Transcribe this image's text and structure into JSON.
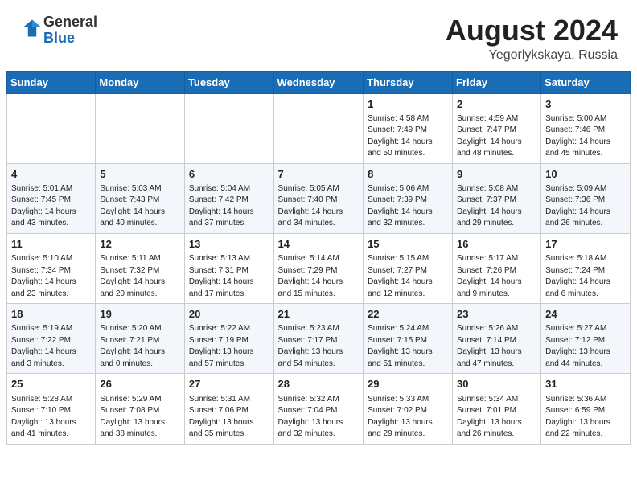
{
  "header": {
    "logo_general": "General",
    "logo_blue": "Blue",
    "month_year": "August 2024",
    "location": "Yegorlykskaya, Russia"
  },
  "days_of_week": [
    "Sunday",
    "Monday",
    "Tuesday",
    "Wednesday",
    "Thursday",
    "Friday",
    "Saturday"
  ],
  "weeks": [
    [
      {
        "day": "",
        "info": ""
      },
      {
        "day": "",
        "info": ""
      },
      {
        "day": "",
        "info": ""
      },
      {
        "day": "",
        "info": ""
      },
      {
        "day": "1",
        "info": "Sunrise: 4:58 AM\nSunset: 7:49 PM\nDaylight: 14 hours\nand 50 minutes."
      },
      {
        "day": "2",
        "info": "Sunrise: 4:59 AM\nSunset: 7:47 PM\nDaylight: 14 hours\nand 48 minutes."
      },
      {
        "day": "3",
        "info": "Sunrise: 5:00 AM\nSunset: 7:46 PM\nDaylight: 14 hours\nand 45 minutes."
      }
    ],
    [
      {
        "day": "4",
        "info": "Sunrise: 5:01 AM\nSunset: 7:45 PM\nDaylight: 14 hours\nand 43 minutes."
      },
      {
        "day": "5",
        "info": "Sunrise: 5:03 AM\nSunset: 7:43 PM\nDaylight: 14 hours\nand 40 minutes."
      },
      {
        "day": "6",
        "info": "Sunrise: 5:04 AM\nSunset: 7:42 PM\nDaylight: 14 hours\nand 37 minutes."
      },
      {
        "day": "7",
        "info": "Sunrise: 5:05 AM\nSunset: 7:40 PM\nDaylight: 14 hours\nand 34 minutes."
      },
      {
        "day": "8",
        "info": "Sunrise: 5:06 AM\nSunset: 7:39 PM\nDaylight: 14 hours\nand 32 minutes."
      },
      {
        "day": "9",
        "info": "Sunrise: 5:08 AM\nSunset: 7:37 PM\nDaylight: 14 hours\nand 29 minutes."
      },
      {
        "day": "10",
        "info": "Sunrise: 5:09 AM\nSunset: 7:36 PM\nDaylight: 14 hours\nand 26 minutes."
      }
    ],
    [
      {
        "day": "11",
        "info": "Sunrise: 5:10 AM\nSunset: 7:34 PM\nDaylight: 14 hours\nand 23 minutes."
      },
      {
        "day": "12",
        "info": "Sunrise: 5:11 AM\nSunset: 7:32 PM\nDaylight: 14 hours\nand 20 minutes."
      },
      {
        "day": "13",
        "info": "Sunrise: 5:13 AM\nSunset: 7:31 PM\nDaylight: 14 hours\nand 17 minutes."
      },
      {
        "day": "14",
        "info": "Sunrise: 5:14 AM\nSunset: 7:29 PM\nDaylight: 14 hours\nand 15 minutes."
      },
      {
        "day": "15",
        "info": "Sunrise: 5:15 AM\nSunset: 7:27 PM\nDaylight: 14 hours\nand 12 minutes."
      },
      {
        "day": "16",
        "info": "Sunrise: 5:17 AM\nSunset: 7:26 PM\nDaylight: 14 hours\nand 9 minutes."
      },
      {
        "day": "17",
        "info": "Sunrise: 5:18 AM\nSunset: 7:24 PM\nDaylight: 14 hours\nand 6 minutes."
      }
    ],
    [
      {
        "day": "18",
        "info": "Sunrise: 5:19 AM\nSunset: 7:22 PM\nDaylight: 14 hours\nand 3 minutes."
      },
      {
        "day": "19",
        "info": "Sunrise: 5:20 AM\nSunset: 7:21 PM\nDaylight: 14 hours\nand 0 minutes."
      },
      {
        "day": "20",
        "info": "Sunrise: 5:22 AM\nSunset: 7:19 PM\nDaylight: 13 hours\nand 57 minutes."
      },
      {
        "day": "21",
        "info": "Sunrise: 5:23 AM\nSunset: 7:17 PM\nDaylight: 13 hours\nand 54 minutes."
      },
      {
        "day": "22",
        "info": "Sunrise: 5:24 AM\nSunset: 7:15 PM\nDaylight: 13 hours\nand 51 minutes."
      },
      {
        "day": "23",
        "info": "Sunrise: 5:26 AM\nSunset: 7:14 PM\nDaylight: 13 hours\nand 47 minutes."
      },
      {
        "day": "24",
        "info": "Sunrise: 5:27 AM\nSunset: 7:12 PM\nDaylight: 13 hours\nand 44 minutes."
      }
    ],
    [
      {
        "day": "25",
        "info": "Sunrise: 5:28 AM\nSunset: 7:10 PM\nDaylight: 13 hours\nand 41 minutes."
      },
      {
        "day": "26",
        "info": "Sunrise: 5:29 AM\nSunset: 7:08 PM\nDaylight: 13 hours\nand 38 minutes."
      },
      {
        "day": "27",
        "info": "Sunrise: 5:31 AM\nSunset: 7:06 PM\nDaylight: 13 hours\nand 35 minutes."
      },
      {
        "day": "28",
        "info": "Sunrise: 5:32 AM\nSunset: 7:04 PM\nDaylight: 13 hours\nand 32 minutes."
      },
      {
        "day": "29",
        "info": "Sunrise: 5:33 AM\nSunset: 7:02 PM\nDaylight: 13 hours\nand 29 minutes."
      },
      {
        "day": "30",
        "info": "Sunrise: 5:34 AM\nSunset: 7:01 PM\nDaylight: 13 hours\nand 26 minutes."
      },
      {
        "day": "31",
        "info": "Sunrise: 5:36 AM\nSunset: 6:59 PM\nDaylight: 13 hours\nand 22 minutes."
      }
    ]
  ]
}
